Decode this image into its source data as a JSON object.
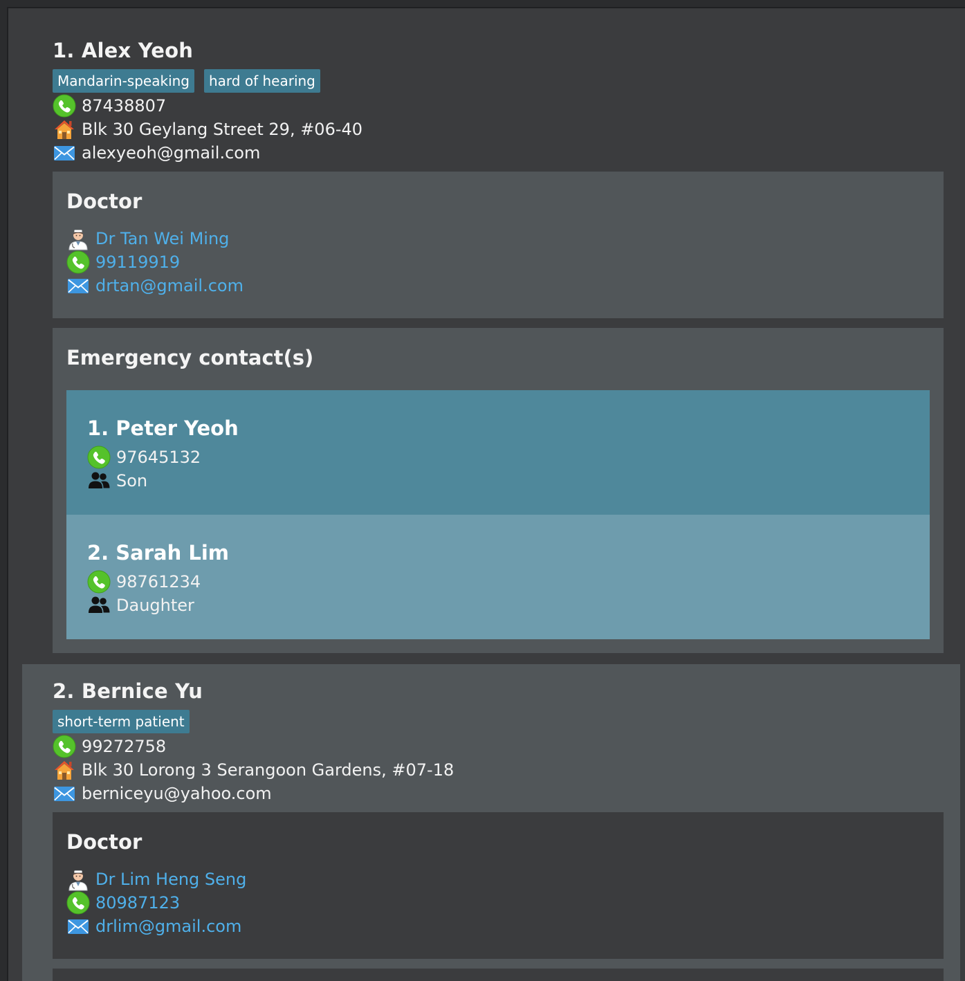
{
  "patients": [
    {
      "index_name": "1. Alex Yeoh",
      "tags": [
        "Mandarin-speaking",
        "hard of hearing"
      ],
      "phone": "87438807",
      "address": "Blk 30 Geylang Street 29, #06-40",
      "email": "alexyeoh@gmail.com",
      "doctor": {
        "heading": "Doctor",
        "name": "Dr Tan Wei Ming",
        "phone": "99119919",
        "email": "drtan@gmail.com"
      },
      "emergency": {
        "heading": "Emergency contact(s)",
        "contacts": [
          {
            "index_name": "1. Peter Yeoh",
            "phone": "97645132",
            "relationship": "Son"
          },
          {
            "index_name": "2. Sarah Lim",
            "phone": "98761234",
            "relationship": "Daughter"
          }
        ]
      }
    },
    {
      "index_name": "2. Bernice Yu",
      "tags": [
        "short-term patient"
      ],
      "phone": "99272758",
      "address": "Blk 30 Lorong 3 Serangoon Gardens, #07-18",
      "email": "berniceyu@yahoo.com",
      "doctor": {
        "heading": "Doctor",
        "name": "Dr Lim Heng Seng",
        "phone": "80987123",
        "email": "drlim@gmail.com"
      }
    }
  ],
  "colors": {
    "background": "#3b3c3e",
    "selected_card": "#515659",
    "tag": "#3e7b91",
    "link": "#4fb0ea",
    "emergency_primary": "#4f889b",
    "emergency_secondary": "#6e9cad"
  },
  "icons": {
    "phone": "phone-icon",
    "address": "home-icon",
    "email": "email-icon",
    "doctor": "doctor-icon",
    "relationship": "people-icon"
  }
}
